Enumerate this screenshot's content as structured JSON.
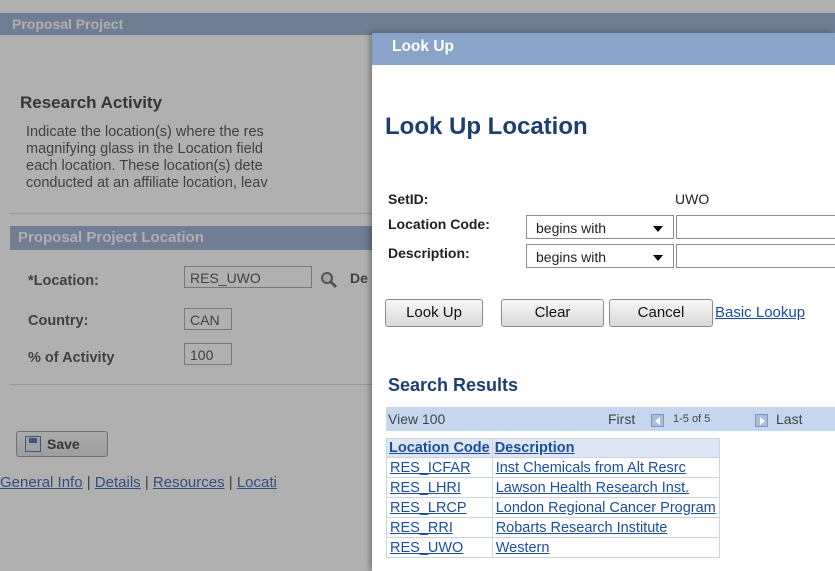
{
  "background": {
    "title": "Proposal Project",
    "section_title": "Research Activity",
    "instructions": "Indicate the location(s) where the res\nmagnifying glass in the Location field\neach location. These location(s) dete\nconducted at an affiliate location, leav",
    "panel_header": "Proposal Project Location",
    "location_label": "*Location:",
    "location_value": "RES_UWO",
    "description_stub": "De",
    "country_label": "Country:",
    "country_value": "CAN",
    "activity_label": "% of Activity",
    "activity_value": "100",
    "save_label": "Save",
    "links": {
      "general_info": "General Info",
      "details": "Details",
      "resources": "Resources",
      "location": "Locati",
      "sep": " | "
    }
  },
  "modal": {
    "title": "Look Up",
    "heading": "Look Up Location",
    "setid_label": "SetID:",
    "setid_value": "UWO",
    "location_code_label": "Location Code:",
    "location_code_operator": "begins with",
    "location_code_value": "",
    "description_label": "Description:",
    "description_operator": "begins with",
    "description_value": "",
    "buttons": {
      "lookup": "Look Up",
      "clear": "Clear",
      "cancel": "Cancel",
      "basic_lookup": "Basic Lookup"
    },
    "results": {
      "title": "Search Results",
      "view": "View 100",
      "first": "First",
      "range": "1-5 of 5",
      "last": "Last",
      "columns": [
        "Location Code",
        "Description"
      ],
      "rows": [
        {
          "code": "RES_ICFAR",
          "description": "Inst Chemicals from Alt Resrc"
        },
        {
          "code": "RES_LHRI",
          "description": "Lawson Health Research Inst."
        },
        {
          "code": "RES_LRCP",
          "description": "London Regional Cancer Program"
        },
        {
          "code": "RES_RRI",
          "description": "Robarts Research Institute"
        },
        {
          "code": "RES_UWO",
          "description": "Western"
        }
      ]
    }
  },
  "colors": {
    "title_bar": "#8aa3c8",
    "heading_blue": "#1d3e73",
    "link_blue": "#1a4e9c",
    "grid_header": "#c5d7ee"
  }
}
